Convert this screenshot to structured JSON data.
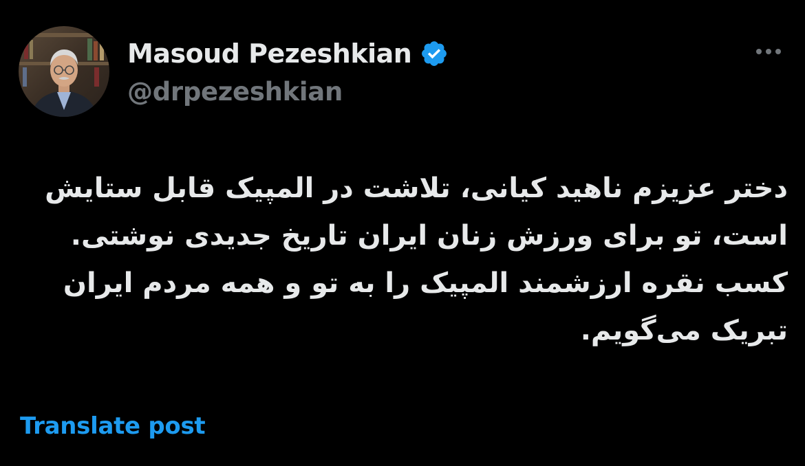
{
  "author": {
    "display_name": "Masoud Pezeshkian",
    "handle": "@drpezeshkian",
    "verified": true,
    "avatar_icon": "profile-photo"
  },
  "post": {
    "text": "دختر عزیزم  ناهید کیانی، تلاشت در المپیک قابل ستایش است، تو برای ورزش زنان ایران تاریخ جدیدی نوشتی. کسب نقره ارزشمند المپیک را به تو و همه مردم ایران تبریک می‌گویم."
  },
  "actions": {
    "more_icon": "more-horizontal-icon",
    "translate_label": "Translate post"
  },
  "colors": {
    "background": "#000000",
    "primary_text": "#e7e9ea",
    "secondary_text": "#71767b",
    "accent": "#1d9bf0"
  }
}
